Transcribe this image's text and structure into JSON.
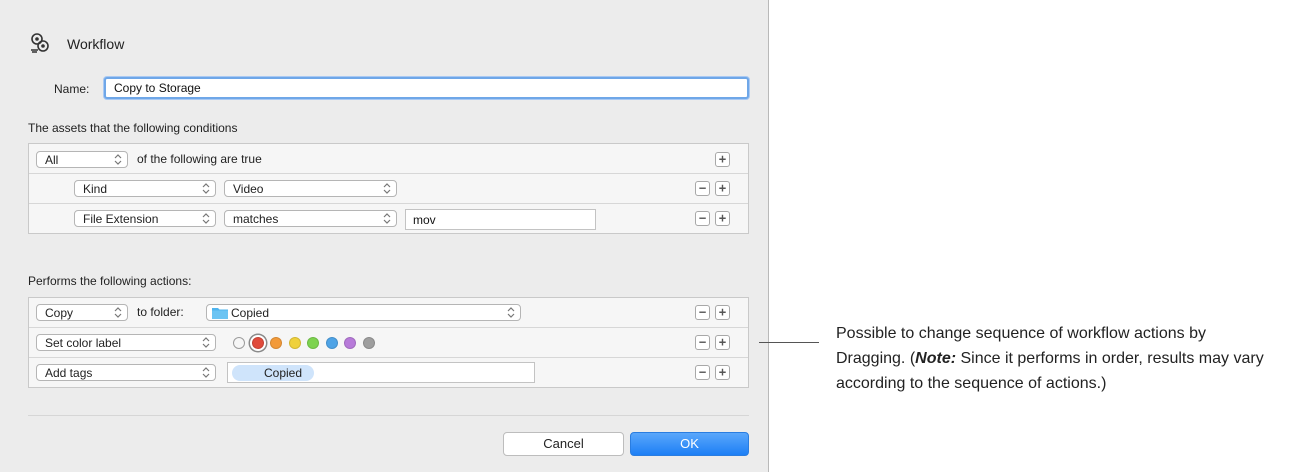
{
  "dialog": {
    "title": "Workflow",
    "name_label": "Name:",
    "name_value": "Copy to Storage",
    "conditions_label": "The assets that the following conditions",
    "conditions": {
      "match_select": "All",
      "match_suffix": "of the following are true",
      "rows": [
        {
          "field": "Kind",
          "operator": "Video"
        },
        {
          "field": "File Extension",
          "operator": "matches",
          "value": "mov"
        }
      ]
    },
    "actions_label": "Performs the following actions:",
    "actions": {
      "copy": {
        "action": "Copy",
        "to_label": "to folder:",
        "folder": "Copied"
      },
      "color": {
        "action": "Set color label",
        "colors": [
          "none",
          "#e04b3c",
          "#f29a3a",
          "#efd13c",
          "#7dd34f",
          "#4ea3e6",
          "#b77ad9",
          "#9e9e9e"
        ]
      },
      "tags": {
        "action": "Add tags",
        "tag": "Copied"
      }
    },
    "cancel_label": "Cancel",
    "ok_label": "OK"
  },
  "callout": {
    "text_1": "Possible to change sequence of workflow actions by Dragging. (",
    "note_label": "Note:",
    "text_2": " Since it performs in order, results may vary according to the sequence of actions.)"
  }
}
